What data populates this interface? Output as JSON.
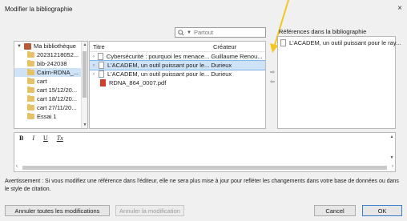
{
  "window": {
    "title": "Modifier la bibliographie",
    "close_label": "×"
  },
  "search": {
    "placeholder": "Partout"
  },
  "references_panel": {
    "title": "Références dans la bibliographie",
    "items": [
      {
        "label": "L'ACADEM, un outil puissant pour le ray..."
      }
    ]
  },
  "library_tree": {
    "items": [
      {
        "label": "Ma bibliothèque",
        "icon": "library-icon",
        "selected": false
      },
      {
        "label": "20231218052...",
        "icon": "folder-icon",
        "selected": false
      },
      {
        "label": "bib-242038",
        "icon": "folder-icon",
        "selected": false
      },
      {
        "label": "Cairn-RDNA_...",
        "icon": "folder-icon",
        "selected": true
      },
      {
        "label": "cart",
        "icon": "folder-icon",
        "selected": false
      },
      {
        "label": "cart 15/12/20...",
        "icon": "folder-icon",
        "selected": false
      },
      {
        "label": "cart 18/12/20...",
        "icon": "folder-icon",
        "selected": false
      },
      {
        "label": "cart 27/11/20...",
        "icon": "folder-icon",
        "selected": false
      },
      {
        "label": "Essai 1",
        "icon": "folder-icon",
        "selected": false
      }
    ]
  },
  "items_table": {
    "columns": {
      "title": "Titre",
      "creator": "Créateur"
    },
    "rows": [
      {
        "title": "Cybersécurité : pourquoi les menace...",
        "creator": "Guillaume Renou...",
        "expandable": true,
        "icon": "document-icon",
        "selected": false
      },
      {
        "title": "L'ACADEM, un outil puissant pour le...",
        "creator": "Durieux",
        "expandable": true,
        "icon": "document-icon",
        "selected": true
      },
      {
        "title": "L'ACADEM, un outil puissant pour le...",
        "creator": "Durieux",
        "expandable": true,
        "icon": "document-icon",
        "selected": false
      },
      {
        "title": "RDNA_864_0007.pdf",
        "creator": "",
        "expandable": false,
        "icon": "pdf-icon",
        "selected": false
      }
    ]
  },
  "editor_toolbar": {
    "bold": "B",
    "italic": "I",
    "underline": "U",
    "clear_format": "Tx"
  },
  "warning_text": "Avertissement : Si vous modifiez une référence dans l'éditeur, elle ne sera plus mise à jour pour refléter les changements dans votre base de données ou dans le style de citation.",
  "buttons": {
    "revert_all": "Annuler toutes les modifications",
    "revert": "Annuler la modification",
    "cancel": "Cancel",
    "ok": "OK"
  },
  "colors": {
    "selection": "#cfe3f7",
    "annotation_arrow": "#f5c518",
    "folder": "#e8c165"
  }
}
